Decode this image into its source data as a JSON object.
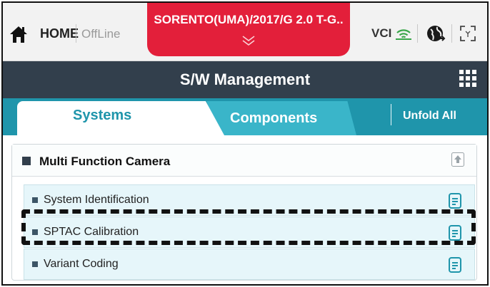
{
  "header": {
    "home_label": "HOME",
    "offline_label": "OffLine",
    "vehicle": "SORENTO(UMA)/2017/G 2.0 T-G..",
    "vci_label": "VCI"
  },
  "titlebar": {
    "title": "S/W Management"
  },
  "tabs": {
    "systems": "Systems",
    "components": "Components",
    "unfold_all": "Unfold All",
    "active": "Systems"
  },
  "panel": {
    "title": "Multi Function Camera",
    "items": [
      {
        "label": "System Identification"
      },
      {
        "label": "SPTAC Calibration",
        "highlighted": true
      },
      {
        "label": "Variant Coding"
      }
    ]
  },
  "colors": {
    "vehicle_tab": "#e31f3a",
    "titlebar": "#323f4c",
    "tabbar": "#1f95ab",
    "tab_inactive": "#3ab5c9",
    "row_bg": "#e6f6fa",
    "icon_teal": "#1f95ab",
    "vci_green": "#3aa64a"
  },
  "icons": [
    "home-icon",
    "chevron-down-icon",
    "wifi-icon",
    "globe-icon",
    "fullscreen-icon",
    "grid-menu-icon",
    "collapse-icon",
    "document-icon"
  ]
}
